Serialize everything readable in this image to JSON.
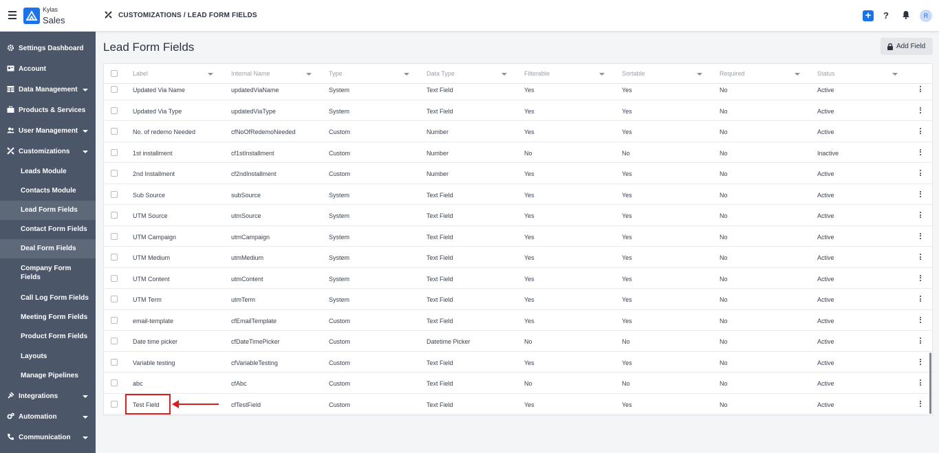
{
  "header": {
    "brand_top": "Kylas",
    "brand_bottom": "Sales",
    "breadcrumb": "CUSTOMIZATIONS / LEAD FORM FIELDS",
    "plus_label": "+",
    "help_label": "?",
    "avatar_initial": "R",
    "accent_color": "#1a73e8"
  },
  "sidebar": {
    "items": [
      {
        "label": "Settings Dashboard",
        "icon": "gear-icon"
      },
      {
        "label": "Account",
        "icon": "id-card-icon"
      },
      {
        "label": "Data Management",
        "icon": "table-icon"
      },
      {
        "label": "Products & Services",
        "icon": "briefcase-icon"
      },
      {
        "label": "User Management",
        "icon": "users-icon"
      },
      {
        "label": "Customizations",
        "icon": "tools-icon"
      },
      {
        "label": "Integrations",
        "icon": "plug-icon"
      },
      {
        "label": "Automation",
        "icon": "cogs-icon"
      },
      {
        "label": "Communication",
        "icon": "phone-icon"
      }
    ],
    "sub_items": [
      {
        "label": "Leads Module"
      },
      {
        "label": "Contacts Module"
      },
      {
        "label": "Lead Form Fields"
      },
      {
        "label": "Contact Form Fields"
      },
      {
        "label": "Deal Form Fields"
      },
      {
        "label": "Company Form Fields"
      },
      {
        "label": "Call Log Form Fields"
      },
      {
        "label": "Meeting Form Fields"
      },
      {
        "label": "Product Form Fields"
      },
      {
        "label": "Layouts"
      },
      {
        "label": "Manage Pipelines"
      }
    ]
  },
  "main": {
    "title": "Lead Form Fields",
    "add_button": "Add Field",
    "columns": [
      "Label",
      "Internal Name",
      "Type",
      "Data Type",
      "Filterable",
      "Sortable",
      "Required",
      "Status"
    ],
    "rows": [
      [
        "Updated Via Name",
        "updatedViaName",
        "System",
        "Text Field",
        "Yes",
        "Yes",
        "No",
        "Active"
      ],
      [
        "Updated Via Type",
        "updatedViaType",
        "System",
        "Text Field",
        "Yes",
        "Yes",
        "No",
        "Active"
      ],
      [
        "No. of redemo Needed",
        "cfNoOfRedemoNeeded",
        "Custom",
        "Number",
        "Yes",
        "Yes",
        "No",
        "Active"
      ],
      [
        "1st installment",
        "cf1stInstallment",
        "Custom",
        "Number",
        "No",
        "No",
        "No",
        "Inactive"
      ],
      [
        "2nd Installment",
        "cf2ndInstallment",
        "Custom",
        "Number",
        "Yes",
        "Yes",
        "No",
        "Active"
      ],
      [
        "Sub Source",
        "subSource",
        "System",
        "Text Field",
        "Yes",
        "Yes",
        "No",
        "Active"
      ],
      [
        "UTM Source",
        "utmSource",
        "System",
        "Text Field",
        "Yes",
        "Yes",
        "No",
        "Active"
      ],
      [
        "UTM Campaign",
        "utmCampaign",
        "System",
        "Text Field",
        "Yes",
        "Yes",
        "No",
        "Active"
      ],
      [
        "UTM Medium",
        "utmMedium",
        "System",
        "Text Field",
        "Yes",
        "Yes",
        "No",
        "Active"
      ],
      [
        "UTM Content",
        "utmContent",
        "System",
        "Text Field",
        "Yes",
        "Yes",
        "No",
        "Active"
      ],
      [
        "UTM Term",
        "utmTerm",
        "System",
        "Text Field",
        "Yes",
        "Yes",
        "No",
        "Active"
      ],
      [
        "email-template",
        "cfEmailTemplate",
        "Custom",
        "Text Field",
        "Yes",
        "Yes",
        "No",
        "Active"
      ],
      [
        "Date time picker",
        "cfDateTimePicker",
        "Custom",
        "Datetime Picker",
        "No",
        "No",
        "No",
        "Active"
      ],
      [
        "Variable testing",
        "cfVariableTesting",
        "Custom",
        "Text Field",
        "Yes",
        "Yes",
        "No",
        "Active"
      ],
      [
        "abc",
        "cfAbc",
        "Custom",
        "Text Field",
        "No",
        "No",
        "No",
        "Active"
      ],
      [
        "Test Field",
        "cfTestField",
        "Custom",
        "Text Field",
        "Yes",
        "Yes",
        "No",
        "Active"
      ]
    ],
    "annotation_color": "#e01b1b"
  }
}
